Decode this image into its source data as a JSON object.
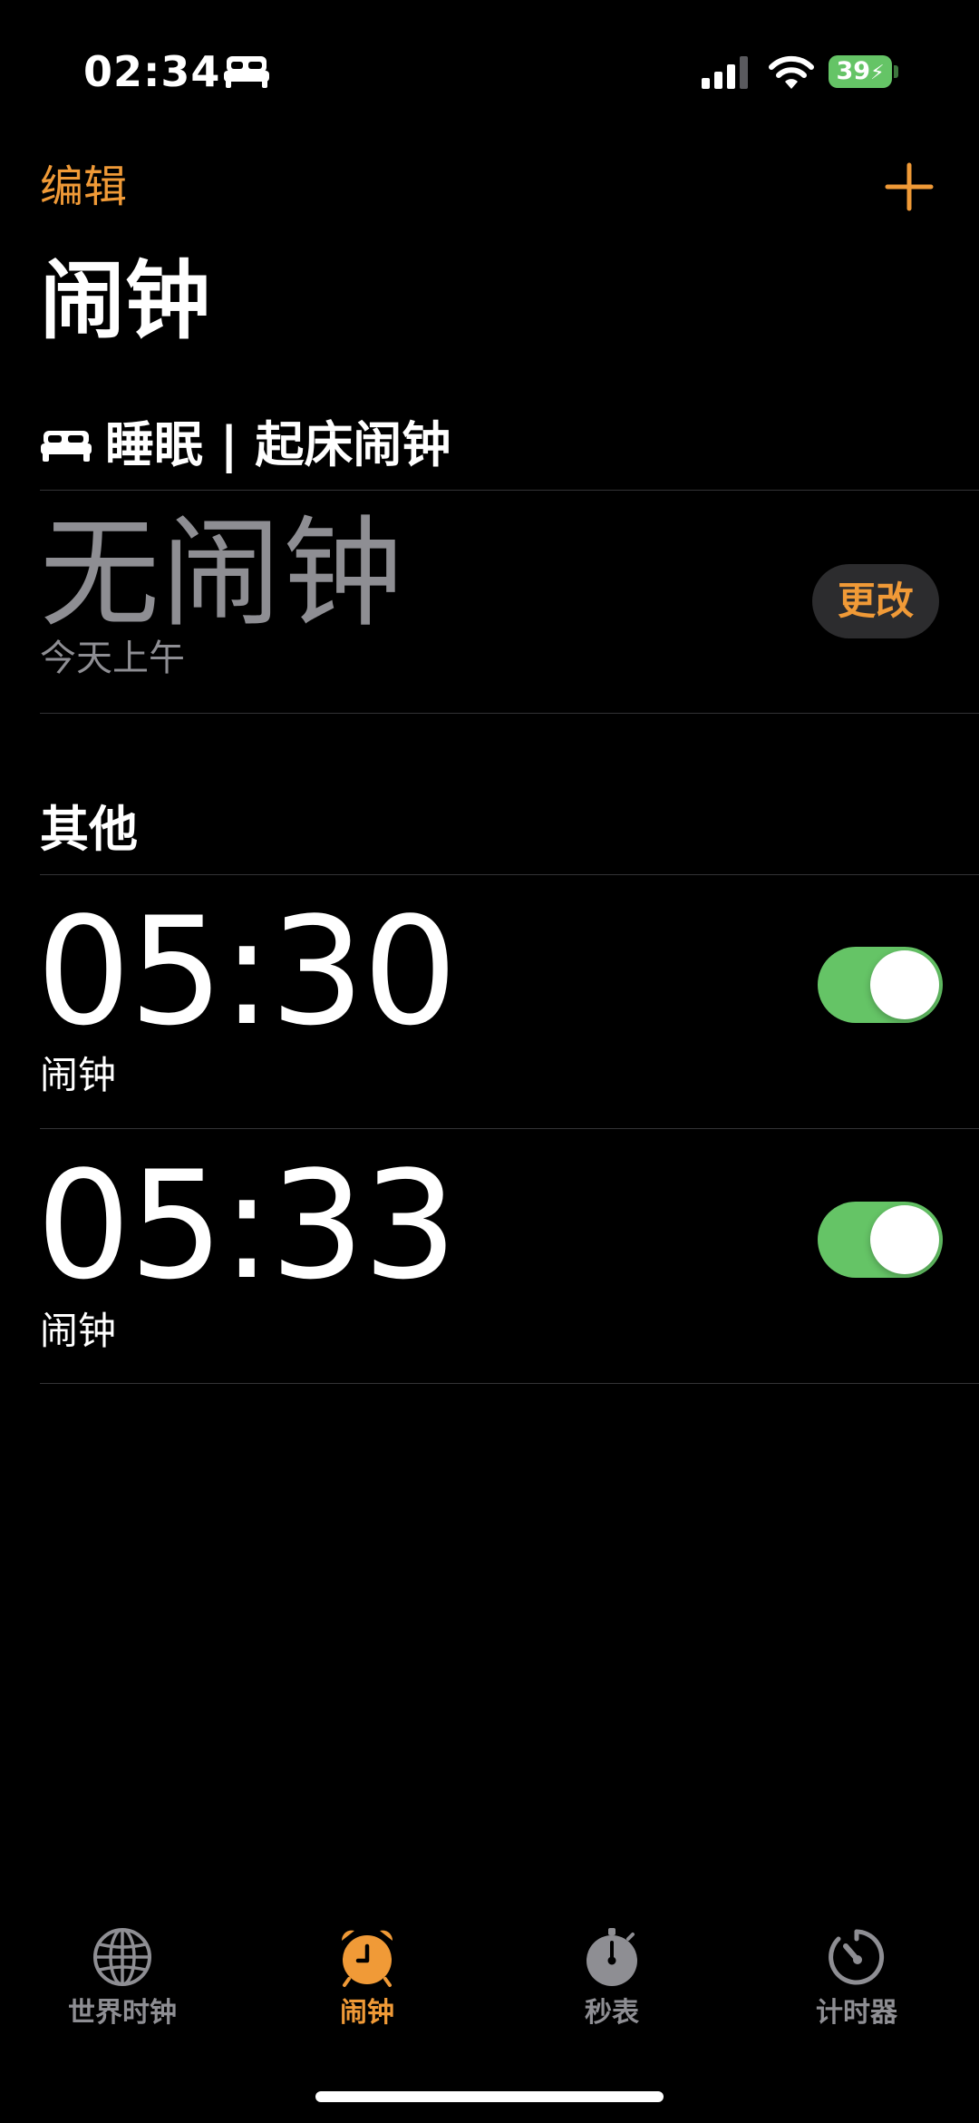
{
  "status_bar": {
    "time": "02:34",
    "focus_icon": "bed-icon",
    "battery_level": "39",
    "battery_charging": true,
    "battery_color": "#65c466"
  },
  "nav": {
    "edit_label": "编辑",
    "add_icon": "plus-icon",
    "accent_color": "#f09a37"
  },
  "page": {
    "title": "闹钟"
  },
  "sleep": {
    "header": "睡眠 | 起床闹钟",
    "header_icon": "bed-icon",
    "no_alarm_label": "无闹钟",
    "subtitle": "今天上午",
    "change_label": "更改"
  },
  "others": {
    "header": "其他",
    "alarms": [
      {
        "time": "05:30",
        "label": "闹钟",
        "enabled": true
      },
      {
        "time": "05:33",
        "label": "闹钟",
        "enabled": true
      }
    ]
  },
  "tabs": [
    {
      "label": "世界时钟",
      "icon": "globe-icon",
      "active": false
    },
    {
      "label": "闹钟",
      "icon": "alarm-clock-icon",
      "active": true
    },
    {
      "label": "秒表",
      "icon": "stopwatch-icon",
      "active": false
    },
    {
      "label": "计时器",
      "icon": "timer-icon",
      "active": false
    }
  ]
}
